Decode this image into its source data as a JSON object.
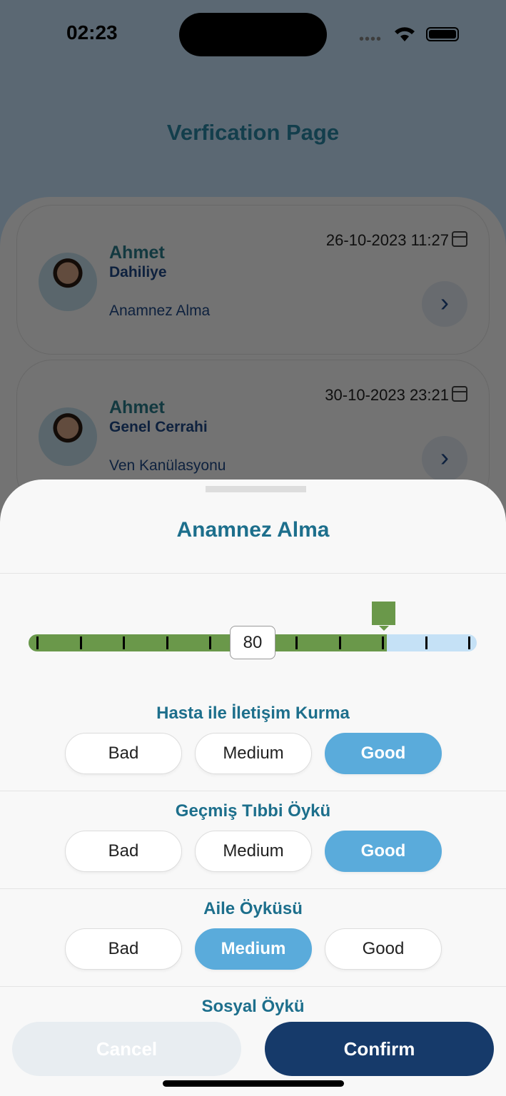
{
  "status": {
    "time": "02:23"
  },
  "page": {
    "title": "Verfication Page"
  },
  "cards": [
    {
      "name": "Ahmet",
      "department": "Dahiliye",
      "procedure": "Anamnez Alma",
      "date": "26-10-2023 11:27"
    },
    {
      "name": "Ahmet",
      "department": "Genel Cerrahi",
      "procedure": "Ven Kanülasyonu",
      "date": "30-10-2023 23:21"
    }
  ],
  "sheet": {
    "title": "Anamnez Alma",
    "score": {
      "value": 80,
      "min": 0,
      "max": 100,
      "label": "80"
    },
    "colors": {
      "fill": "#6a984a",
      "track": "#c5e1f6",
      "selected": "#5aabdb",
      "confirm": "#163a6a"
    },
    "questions": [
      {
        "title": "Hasta ile İletişim Kurma",
        "options": [
          "Bad",
          "Medium",
          "Good"
        ],
        "selected": "Good"
      },
      {
        "title": "Geçmiş Tıbbi Öykü",
        "options": [
          "Bad",
          "Medium",
          "Good"
        ],
        "selected": "Good"
      },
      {
        "title": "Aile Öyküsü",
        "options": [
          "Bad",
          "Medium",
          "Good"
        ],
        "selected": "Medium"
      },
      {
        "title": "Sosyal Öykü"
      }
    ],
    "cancel_label": "Cancel",
    "confirm_label": "Confirm"
  }
}
